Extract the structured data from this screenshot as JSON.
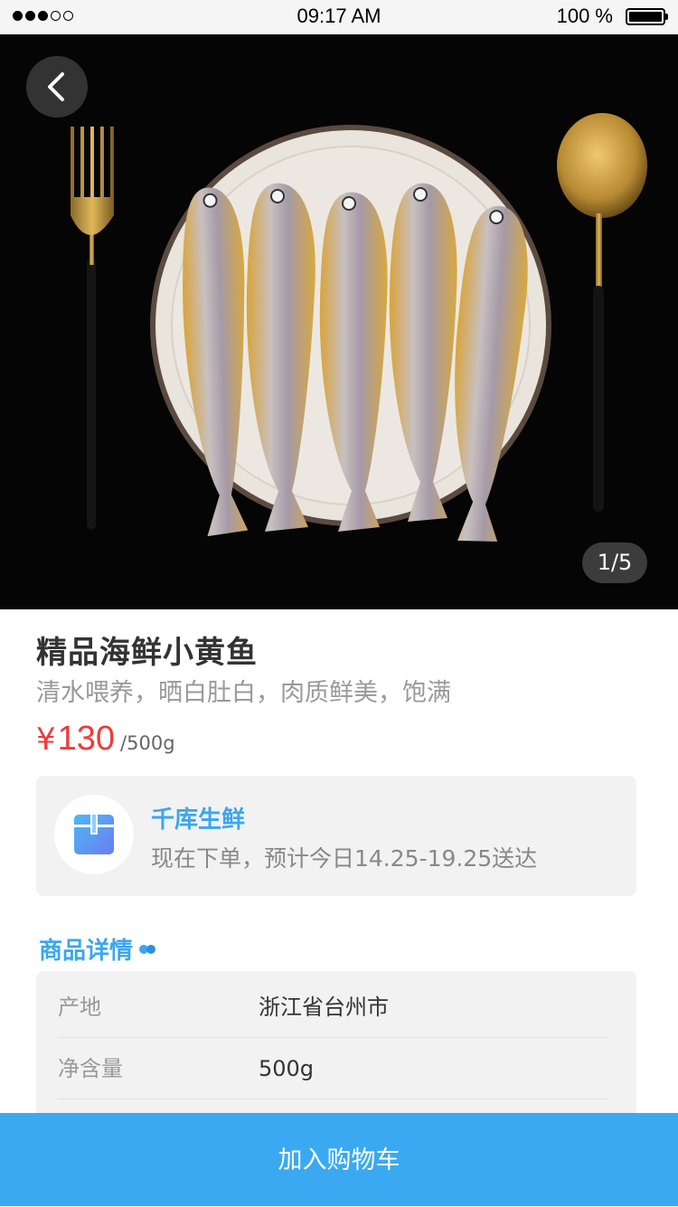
{
  "status_bar": {
    "time": "09:17 AM",
    "battery": "100 %"
  },
  "gallery": {
    "counter": "1/5"
  },
  "product": {
    "title": "精品海鲜小黄鱼",
    "subtitle": "清水喂养，晒白肚白，肉质鲜美，饱满",
    "currency": "¥",
    "price": "130",
    "unit": "/500g"
  },
  "store": {
    "name": "千库生鲜",
    "delivery": "现在下单，预计今日14.25-19.25送达"
  },
  "details": {
    "title": "商品详情",
    "rows": [
      {
        "label": "产地",
        "value": "浙江省台州市"
      },
      {
        "label": "净含量",
        "value": "500g"
      }
    ]
  },
  "cart_button": "加入购物车",
  "colors": {
    "accent": "#3aa9f2",
    "price": "#f03a3a"
  }
}
